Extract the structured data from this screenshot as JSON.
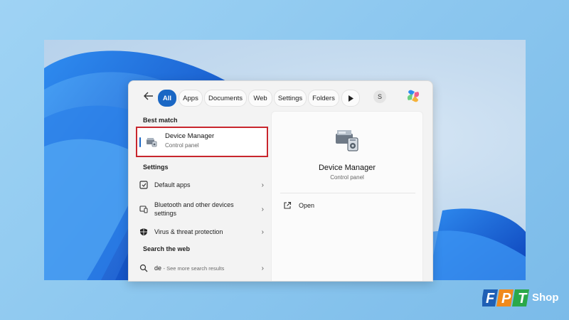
{
  "filters": {
    "back_icon": "back-arrow-icon",
    "chips": [
      "All",
      "Apps",
      "Documents",
      "Web",
      "Settings",
      "Folders"
    ],
    "active": "All",
    "more_icon": "play-icon",
    "avatar_letter": "S",
    "copilot_icon": "copilot-icon"
  },
  "best_match": {
    "heading": "Best match",
    "title": "Device Manager",
    "subtitle": "Control panel",
    "icon": "device-manager-icon"
  },
  "settings": {
    "heading": "Settings",
    "items": [
      {
        "label": "Default apps",
        "icon": "default-apps-icon"
      },
      {
        "label": "Bluetooth and other devices settings",
        "icon": "bluetooth-devices-icon"
      },
      {
        "label": "Virus & threat protection",
        "icon": "shield-icon"
      }
    ]
  },
  "web": {
    "heading": "Search the web",
    "query": "de",
    "hint": "- See more search results",
    "icon": "search-icon"
  },
  "preview": {
    "title": "Device Manager",
    "subtitle": "Control panel",
    "open_label": "Open",
    "open_icon": "open-external-icon"
  },
  "brand": {
    "letters": [
      "F",
      "P",
      "T"
    ],
    "word": "Shop",
    "colors": {
      "blue": "#1e5fb5",
      "orange": "#f08a1c",
      "green": "#2aa84a"
    }
  },
  "colors": {
    "accent": "#1a67c4",
    "highlight": "#c8262d"
  }
}
